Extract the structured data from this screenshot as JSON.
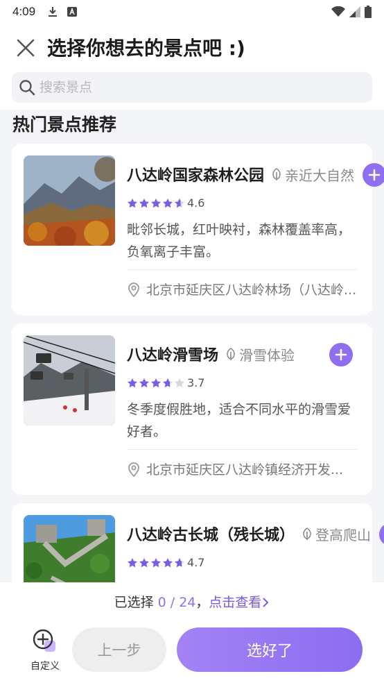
{
  "status_bar": {
    "time": "4:09"
  },
  "header": {
    "title": "选择你想去的景点吧 :)"
  },
  "search": {
    "placeholder": "搜索景点"
  },
  "section": {
    "title": "热门景点推荐"
  },
  "spots": [
    {
      "name": "八达岭国家森林公园",
      "tag": "亲近大自然",
      "rating": "4.6",
      "rating_value": 4.6,
      "desc": "毗邻长城，红叶映衬，森林覆盖率高，负氧离子丰富。",
      "address": "北京市延庆区八达岭林场（八达岭..."
    },
    {
      "name": "八达岭滑雪场",
      "tag": "滑雪体验",
      "rating": "3.7",
      "rating_value": 3.7,
      "desc": "冬季度假胜地，适合不同水平的滑雪爱好者。",
      "address": "北京市延庆区八达岭镇经济开发..."
    },
    {
      "name": "八达岭古长城（残长城）",
      "tag": "登高爬山",
      "rating": "4.7",
      "rating_value": 4.7
    }
  ],
  "bottom": {
    "selected_prefix": "已选择 ",
    "selected_count": "0 / 24",
    "selected_sep": "，",
    "view_link": "点击查看",
    "custom_label": "自定义",
    "prev_label": "上一步",
    "done_label": "选好了"
  },
  "colors": {
    "accent": "#8f6ff0",
    "star_filled": "#7b5ce6",
    "star_empty": "#d6d6db"
  }
}
